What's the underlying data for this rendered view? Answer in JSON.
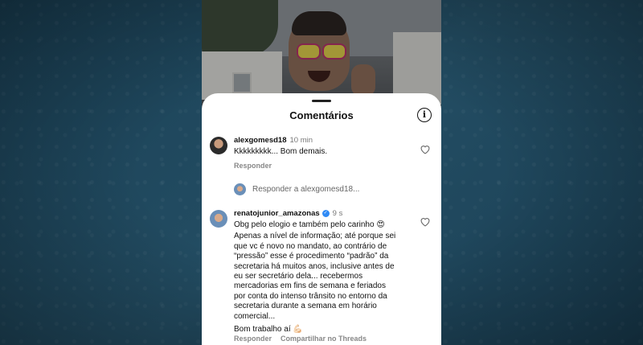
{
  "sheet": {
    "title": "Comentários",
    "info_glyph": "i"
  },
  "comments": [
    {
      "username": "alexgomesd18",
      "time": "10 min",
      "text": "Kkkkkkkkk... Bom demais.",
      "reply_label": "Responder"
    },
    {
      "username": "renatojunior_amazonas",
      "time": "9 s",
      "verified": true,
      "lines": [
        "Obg pelo elogio e também pelo carinho 😍",
        "Apenas a nível de informação; até porque sei",
        "que vc é novo no mandato, ao contrário de",
        "“pressão” esse é procedimento “padrão” da",
        "secretaria há muitos anos, inclusive antes de",
        "eu ser secretário dela... recebermos",
        "mercadorias em fins de semana e feriados",
        "por conta do intenso trânsito no entorno da",
        "secretaria durante a semana em horário",
        "comercial...",
        "Bom trabalho aí 💪🏻"
      ],
      "reply_label": "Responder",
      "threads_label": "Compartilhar no Threads"
    }
  ],
  "reply_prompt": "Responder a alexgomesd18...",
  "icons": [
    "info-icon",
    "heart-icon",
    "verified-badge-icon"
  ],
  "colors": {
    "background": "#1d4458",
    "verified": "#2f8af5"
  }
}
